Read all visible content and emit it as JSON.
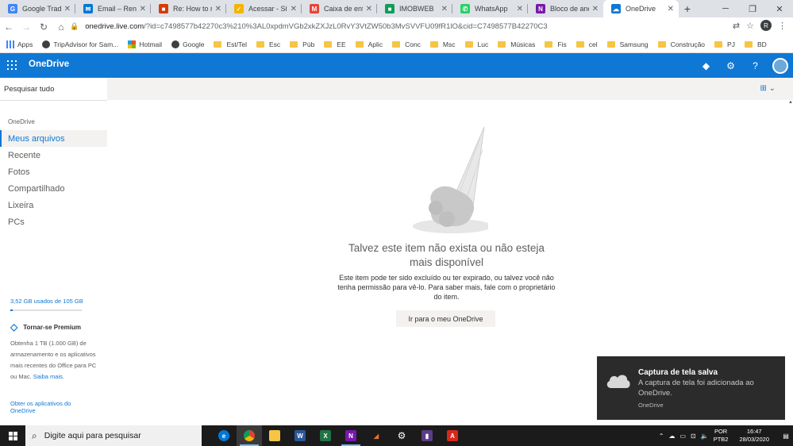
{
  "browser": {
    "tabs": [
      {
        "title": "Google Tradutor",
        "color": "#4285f4",
        "glyph": "G"
      },
      {
        "title": "Email – Renato",
        "color": "#0078d4",
        "glyph": "✉"
      },
      {
        "title": "Re: How to rec",
        "color": "#d83b01",
        "glyph": "■"
      },
      {
        "title": "Acessar - Site d",
        "color": "#f4b400",
        "glyph": "✓"
      },
      {
        "title": "Caixa de entrad",
        "color": "#ea4335",
        "glyph": "M"
      },
      {
        "title": "IMOBWEB",
        "color": "#0f9d58",
        "glyph": "■"
      },
      {
        "title": "WhatsApp",
        "color": "#25d366",
        "glyph": "✆"
      },
      {
        "title": "Bloco de anota",
        "color": "#7719aa",
        "glyph": "N"
      },
      {
        "title": "OneDrive",
        "color": "#0f78d4",
        "glyph": "☁"
      }
    ],
    "url_host": "onedrive.live.com",
    "url_rest": "/?id=c7498577b42270c3%210%3AL0xpdmVGb2xkZXJzL0RvY3VtZW50b3MvSVVFU09fR1lO&cid=C7498577B42270C3",
    "profile_initial": "R",
    "bookmarks": [
      {
        "label": "Apps",
        "kind": "grid"
      },
      {
        "label": "TripAdvisor for Sam...",
        "kind": "site"
      },
      {
        "label": "Hotmail",
        "kind": "ms"
      },
      {
        "label": "Google",
        "kind": "site"
      },
      {
        "label": "Est/Tel",
        "kind": "folder"
      },
      {
        "label": "Esc",
        "kind": "folder"
      },
      {
        "label": "Púb",
        "kind": "folder"
      },
      {
        "label": "EE",
        "kind": "folder"
      },
      {
        "label": "Aplic",
        "kind": "folder"
      },
      {
        "label": "Conc",
        "kind": "folder"
      },
      {
        "label": "Msc",
        "kind": "folder"
      },
      {
        "label": "Luc",
        "kind": "folder"
      },
      {
        "label": "Músicas",
        "kind": "folder"
      },
      {
        "label": "Fis",
        "kind": "folder"
      },
      {
        "label": "cel",
        "kind": "folder"
      },
      {
        "label": "Samsung",
        "kind": "folder"
      },
      {
        "label": "Construção",
        "kind": "folder"
      },
      {
        "label": "PJ",
        "kind": "folder"
      },
      {
        "label": "BD",
        "kind": "folder"
      }
    ]
  },
  "onedrive": {
    "brand": "OneDrive",
    "search_label": "Pesquisar tudo",
    "section_label": "OneDrive",
    "nav": [
      {
        "label": "Meus arquivos",
        "selected": true
      },
      {
        "label": "Recente",
        "selected": false
      },
      {
        "label": "Fotos",
        "selected": false
      },
      {
        "label": "Compartilhado",
        "selected": false
      },
      {
        "label": "Lixeira",
        "selected": false
      },
      {
        "label": "PCs",
        "selected": false
      }
    ],
    "storage_text": "3,52 GB usados de 105 GB",
    "storage_fraction": 0.034,
    "premium_title": "Tornar-se Premium",
    "premium_text": "Obtenha 1 TB (1.000 GB) de armazenamento e os aplicativos mais recentes do Office para PC ou Mac.",
    "premium_link": "Saiba mais.",
    "get_apps": "Obter os aplicativos do OneDrive",
    "empty_title": "Talvez este item não exista ou não esteja mais disponível",
    "empty_desc": "Este item pode ter sido excluído ou ter expirado, ou talvez você não tenha permissão para vê-lo. Para saber mais, fale com o proprietário do item.",
    "go_button": "Ir para o meu OneDrive"
  },
  "toast": {
    "title": "Captura de tela salva",
    "body": "A captura de tela foi adicionada ao OneDrive.",
    "app": "OneDrive"
  },
  "taskbar": {
    "search_placeholder": "Digite aqui para pesquisar",
    "lang_top": "POR",
    "lang_bottom": "PTB2",
    "time": "16:47",
    "date": "28/03/2020"
  }
}
